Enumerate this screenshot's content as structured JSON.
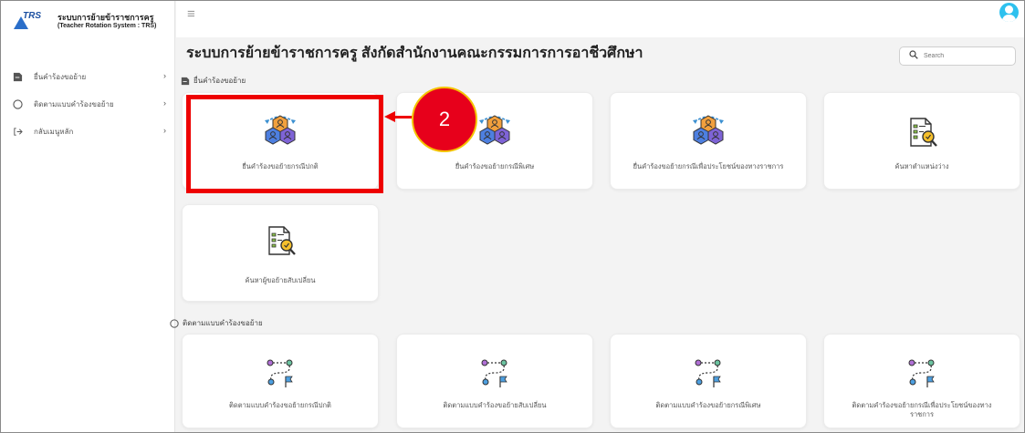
{
  "app": {
    "logo_text": "TRS",
    "title": "ระบบการย้ายข้าราชการครู",
    "subtitle": "(Teacher Rotation System : TRS)"
  },
  "sidebar": {
    "items": [
      {
        "label": "ยื่นคำร้องขอย้าย",
        "icon": "document-icon"
      },
      {
        "label": "ติดตามแบบคำร้องขอย้าย",
        "icon": "circle-icon"
      },
      {
        "label": "กลับเมนูหลัก",
        "icon": "logout-arrow-icon"
      }
    ]
  },
  "header": {
    "page_title": "ระบบการย้ายข้าราชการครู สังกัดสำนักงานคณะกรรมการการอาชีวศึกษา",
    "search_placeholder": "Search"
  },
  "sections": {
    "submit": {
      "label": "ยื่นคำร้องขอย้าย"
    },
    "track": {
      "label": "ติดตามแบบคำร้องขอย้าย"
    }
  },
  "submit_cards": [
    {
      "label": "ยื่นคำร้องขอย้ายกรณีปกติ",
      "icon": "transfer-people-icon"
    },
    {
      "label": "ยื่นคำร้องขอย้ายกรณีพิเศษ",
      "icon": "transfer-people-icon"
    },
    {
      "label": "ยื่นคำร้องขอย้ายกรณีเพื่อประโยชน์ของทางราชการ",
      "icon": "transfer-people-icon"
    },
    {
      "label": "ค้นหาตำแหน่งว่าง",
      "icon": "document-search-icon"
    },
    {
      "label": "ค้นหาผู้ขอย้ายสับเปลี่ยน",
      "icon": "document-search-icon"
    }
  ],
  "track_cards": [
    {
      "label": "ติดตามแบบคำร้องขอย้ายกรณีปกติ",
      "icon": "route-icon"
    },
    {
      "label": "ติดตามแบบคำร้องขอย้ายสับเปลี่ยน",
      "icon": "route-icon"
    },
    {
      "label": "ติดตามแบบคำร้องขอย้ายกรณีพิเศษ",
      "icon": "route-icon"
    },
    {
      "label": "ติดตามคำร้องขอย้ายกรณีเพื่อประโยชน์ของทาง ราชการ",
      "icon": "route-icon"
    }
  ],
  "annotation": {
    "step_number": "2"
  },
  "colors": {
    "accent_blue": "#2ec1ee",
    "highlight_red": "#ee0000",
    "step_fill": "#e7001b",
    "step_ring": "#f4c400"
  }
}
